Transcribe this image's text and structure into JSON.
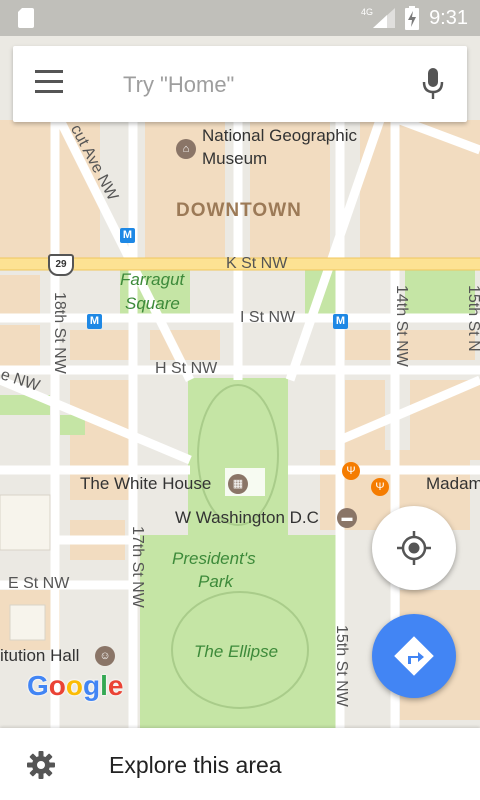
{
  "status_bar": {
    "time": "9:31",
    "network": "4G",
    "icons": [
      "sim-card-icon",
      "signal-icon",
      "battery-charging-icon"
    ]
  },
  "search": {
    "placeholder": "Try \"Home\"",
    "menu_icon": "hamburger-menu-icon",
    "mic_icon": "microphone-icon"
  },
  "map": {
    "district": "DOWNTOWN",
    "pois": [
      {
        "name": "National Geographic\nMuseum",
        "line1": "National Geographic",
        "line2": "Museum"
      },
      {
        "name": "The White House"
      },
      {
        "name": "W Washington D.C"
      },
      {
        "name": "Madam"
      },
      {
        "name": "itution Hall"
      }
    ],
    "parks": [
      {
        "line1": "Farragut",
        "line2": "Square"
      },
      {
        "line1": "President's",
        "line2": "Park"
      },
      {
        "line1": "The Ellipse"
      }
    ],
    "streets": {
      "k": "K St NW",
      "i": "I St NW",
      "h": "H St NW",
      "e": "E St NW",
      "ave": "cut Ave NW",
      "nw": "e NW",
      "s18": "18th St NW",
      "s17": "17th St NW",
      "s14": "14th St NW",
      "s15": "15th St NW",
      "s15b": "15th St N"
    },
    "route_shield": "29",
    "metro": "M"
  },
  "logo": {
    "text": "Google",
    "colors": [
      "#4285f4",
      "#ea4335",
      "#fbbc05",
      "#4285f4",
      "#34a853",
      "#ea4335"
    ]
  },
  "buttons": {
    "my_location_icon": "my-location-icon",
    "directions_icon": "directions-icon"
  },
  "bottom": {
    "label": "Explore this area",
    "icon": "gear-icon"
  },
  "colors": {
    "accent": "#4285f4",
    "park": "#c5e5a5",
    "building": "#f2dcc0"
  }
}
